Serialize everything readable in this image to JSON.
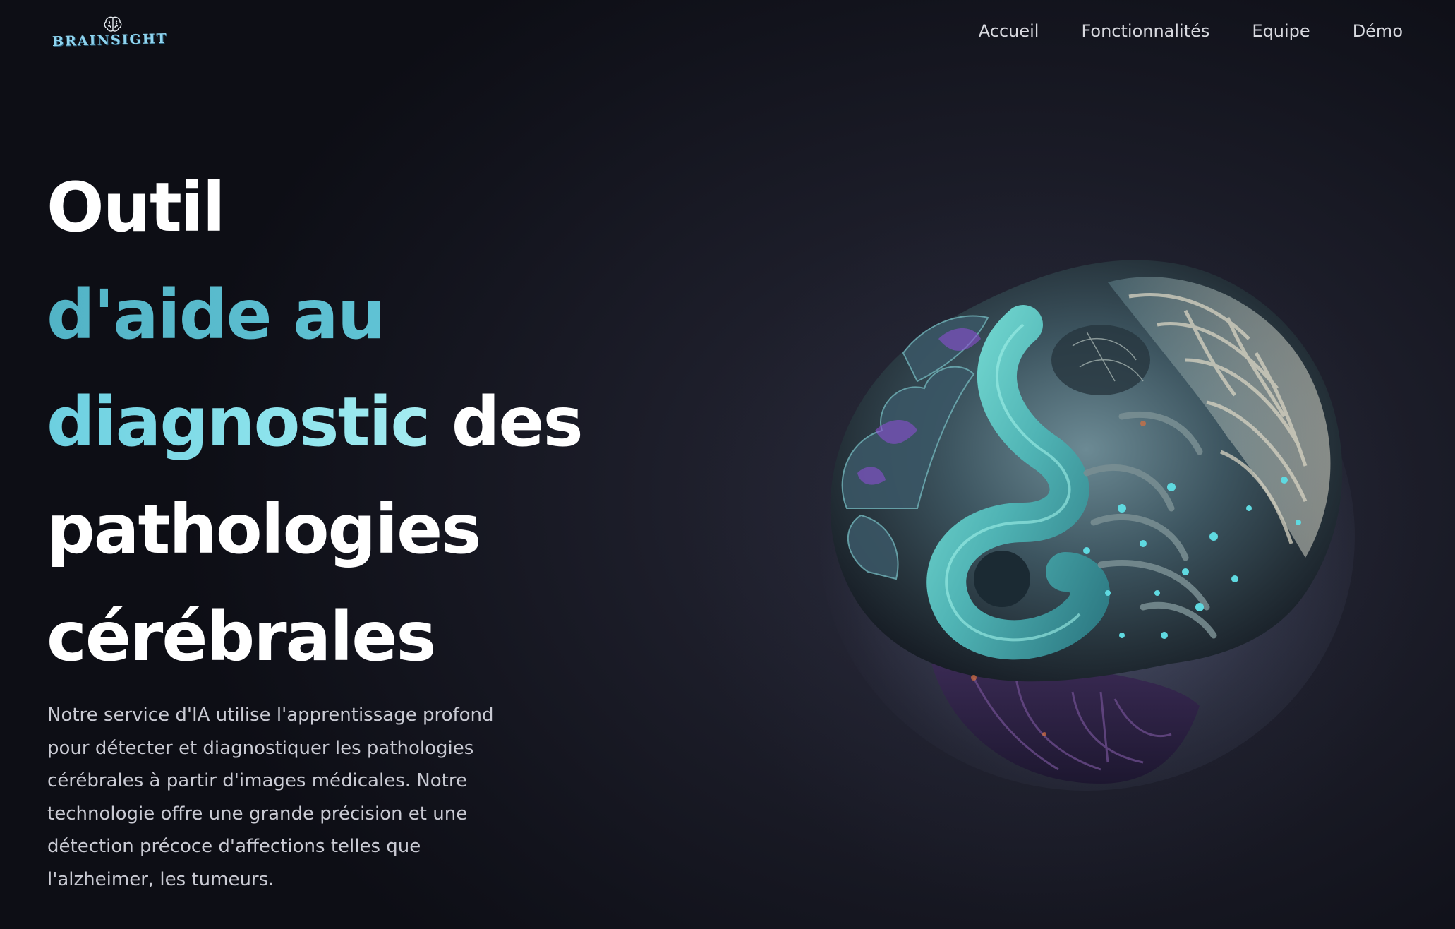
{
  "brand": {
    "name": "BRAINSIGHT",
    "logo_icon": "brain-icon",
    "accent_color": "#8fd4ef"
  },
  "nav": {
    "items": [
      {
        "label": "Accueil"
      },
      {
        "label": "Fonctionnalités"
      },
      {
        "label": "Equipe"
      },
      {
        "label": "Démo"
      }
    ]
  },
  "hero": {
    "headline": {
      "line1": "Outil",
      "line2": "d'aide au",
      "line3_accent": "diagnostic",
      "line3_rest": " des",
      "line4": "pathologies",
      "line5": "cérébrales"
    },
    "description": "Notre service d'IA utilise l'apprentissage profond pour détecter et diagnostiquer les pathologies cérébrales à partir d'images médicales. Notre technologie offre une grande précision et une détection précoce d'affections telles que l'alzheimer, les tumeurs.",
    "image": "brain-illustration",
    "colors": {
      "accent_teal": "#5cbccd",
      "accent_light": "#8de3ec",
      "background": "#1c1d29"
    }
  }
}
